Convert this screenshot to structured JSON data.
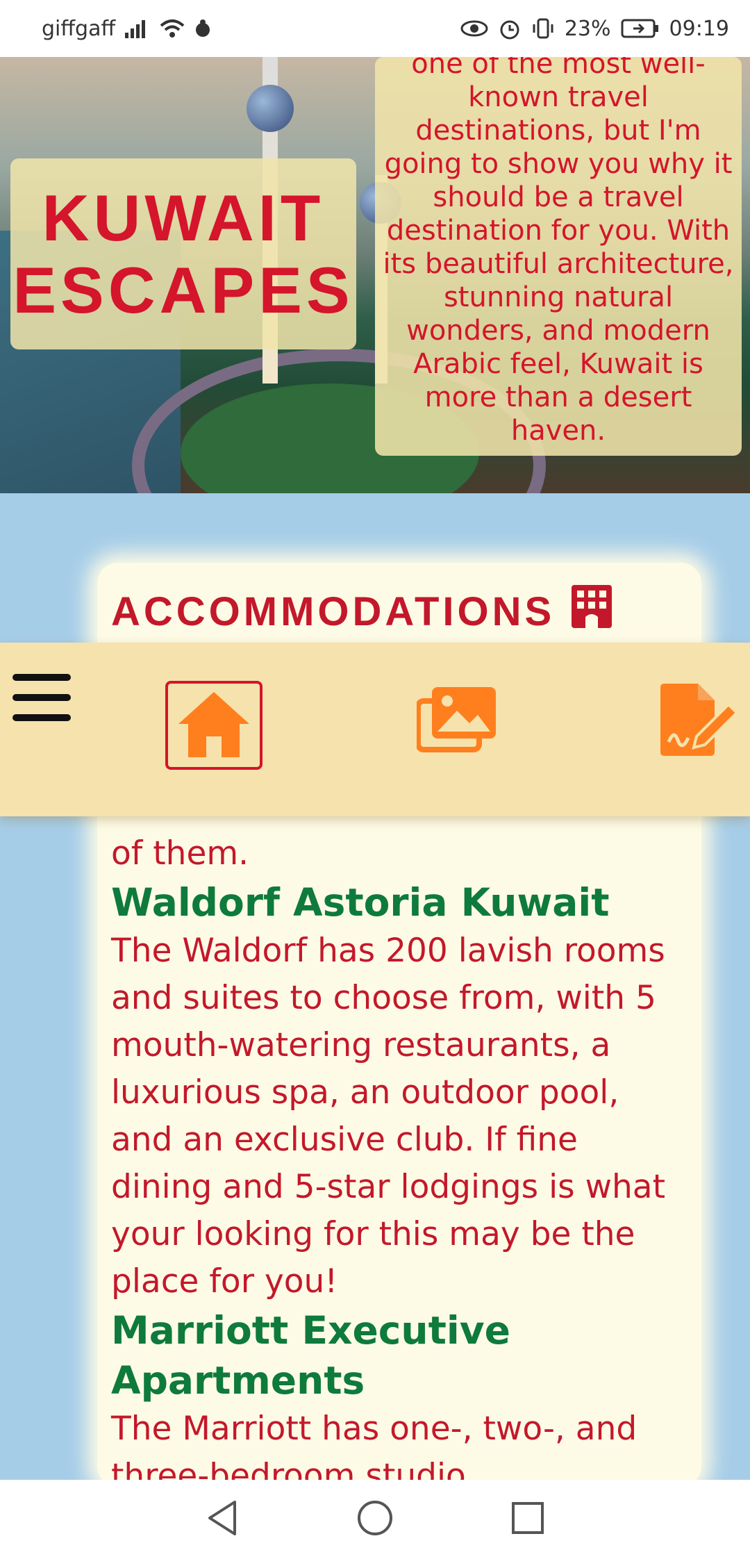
{
  "status_bar": {
    "carrier": "giffgaff",
    "battery": "23%",
    "time": "09:19"
  },
  "hero": {
    "title_line1": "KUWAIT",
    "title_line2": "ESCAPES",
    "intro_text": "one of the most well-known travel destinations, but I'm going to show you why it should be a travel destination for you. With its beautiful architecture, stunning natural wonders, and modern Arabic feel, Kuwait is more than a desert haven."
  },
  "nav": {
    "menu_icon": "hamburger-icon",
    "items": [
      {
        "icon": "home-icon",
        "active": true
      },
      {
        "icon": "gallery-icon",
        "active": false
      },
      {
        "icon": "form-icon",
        "active": false
      }
    ],
    "accent_color": "#ff7f1e"
  },
  "accommodations": {
    "heading": "ACCOMMODATIONS",
    "heading_icon": "hotel-icon",
    "intro_tail": "of them.",
    "hotels": [
      {
        "name": "Waldorf Astoria Kuwait",
        "description": "The Waldorf has 200 lavish rooms and suites to choose from, with 5 mouth-watering restaurants, a luxurious spa, an outdoor pool, and an exclusive club. If fine dining and 5-star lodgings is what your looking for this may be the place for you!"
      },
      {
        "name": "Marriott Executive Apartments",
        "description": "The Marriott has one-, two-, and three-bedroom studio"
      }
    ]
  },
  "colors": {
    "red": "#d4152b",
    "green": "#0e7a3b",
    "background": "#a6cde8",
    "card": "#fdfbe6",
    "nav": "#f6e2ac"
  }
}
